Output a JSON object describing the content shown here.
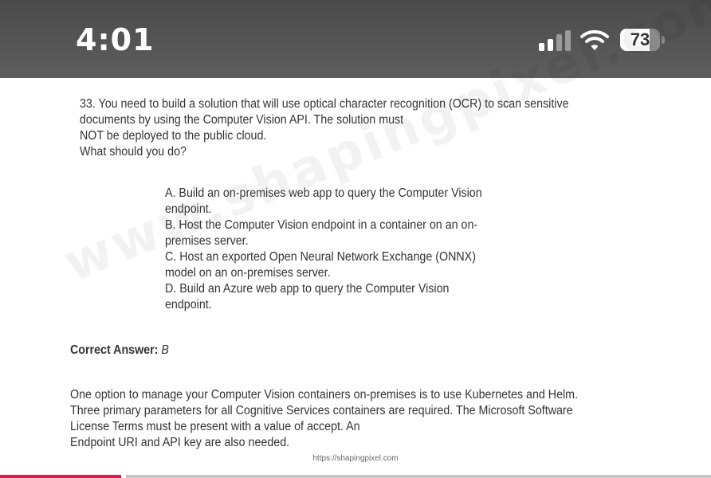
{
  "status_bar": {
    "time": "4:01",
    "battery": "73",
    "battery_level": 0.73,
    "icons": [
      "cellular-signal-icon",
      "wifi-icon",
      "battery-icon"
    ]
  },
  "watermark": "www.shapingpixel.com",
  "question": {
    "lines": [
      "33. You need to build a solution that will use optical character recognition (OCR) to scan sensitive",
      "documents by using the Computer Vision API. The solution must",
      "NOT be deployed to the public cloud.",
      "What should you do?"
    ]
  },
  "options": {
    "lines": [
      "A. Build an on-premises web app to query the Computer Vision",
      "endpoint.",
      "B. Host the Computer Vision endpoint in a container on an on-",
      "premises server.",
      "C. Host an exported Open Neural Network Exchange (ONNX)",
      "model on an on-premises server.",
      "D. Build an Azure web app to query the Computer Vision",
      "endpoint."
    ]
  },
  "answer": {
    "label": "Correct Answer:",
    "value": "B"
  },
  "explanation": {
    "lines": [
      "One option to manage your Computer Vision containers on-premises is to use Kubernetes and Helm.",
      "Three primary parameters for all Cognitive Services containers are required. The Microsoft Software",
      "License Terms must be present with a value of accept. An",
      "Endpoint URI and API key are also needed."
    ]
  },
  "footer_url": "https://shapingpixel.com",
  "reading_progress": 0.17,
  "colors": {
    "status_bar": "#555555",
    "progress": "#e0194f",
    "text": "#333333"
  }
}
